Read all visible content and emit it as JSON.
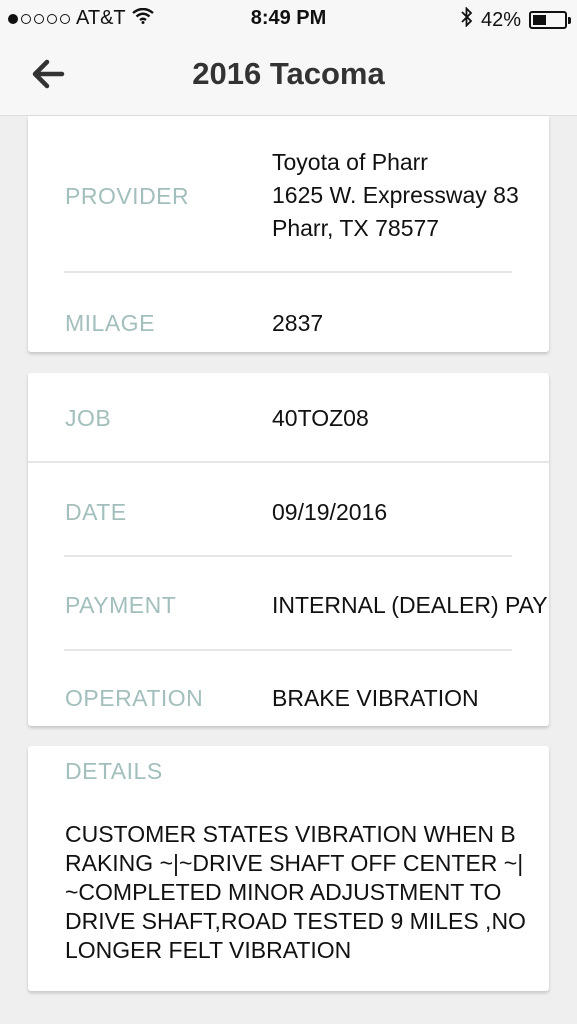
{
  "status_bar": {
    "carrier": "AT&T",
    "time": "8:49 PM",
    "battery": "42%",
    "battery_level": 0.42,
    "icons": [
      "signal-dots-icon",
      "wifi-icon",
      "bluetooth-icon",
      "battery-icon"
    ]
  },
  "nav": {
    "title": "2016 Tacoma",
    "back_icon": "back-arrow-icon"
  },
  "provider_card": {
    "provider_label": "PROVIDER",
    "provider_lines": [
      "Toyota of Pharr",
      "1625 W. Expressway 83",
      "Pharr, TX 78577"
    ],
    "milage_label": "MILAGE",
    "milage_value": "2837"
  },
  "job_card": {
    "job_label": "JOB",
    "job_value": "40TOZ08",
    "date_label": "DATE",
    "date_value": "09/19/2016",
    "payment_label": "PAYMENT",
    "payment_value": "INTERNAL (DEALER) PAY",
    "operation_label": "OPERATION",
    "operation_value": "BRAKE VIBRATION"
  },
  "details_card": {
    "label": "DETAILS",
    "text": "CUSTOMER STATES VIBRATION WHEN B RAKING ~|~DRIVE SHAFT OFF CENTER ~| ~COMPLETED MINOR ADJUSTMENT TO DRIVE SHAFT,ROAD TESTED 9 MILES ,NO LONGER FELT VIBRATION"
  },
  "colors": {
    "label": "#a3bfbd",
    "background": "#efefef",
    "card": "#ffffff"
  }
}
